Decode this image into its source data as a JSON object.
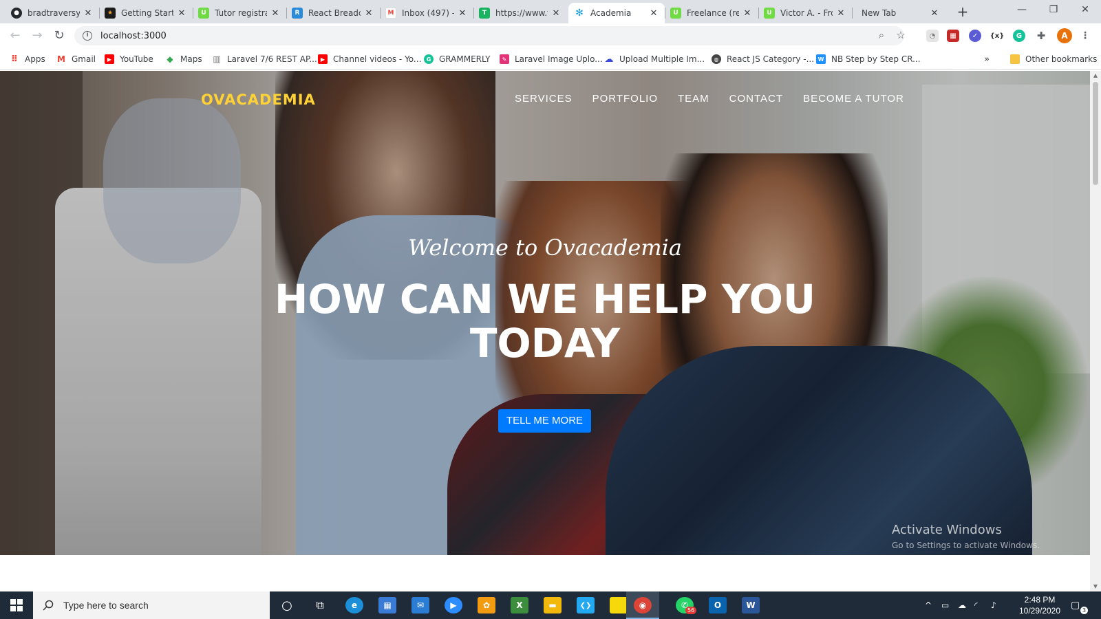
{
  "browser": {
    "tabs": [
      {
        "title": "bradtraversy (",
        "fav": "#24292e",
        "glyph": "●"
      },
      {
        "title": "Getting Starte",
        "fav": "#1b1b1b",
        "glyph": "★"
      },
      {
        "title": "Tutor registra",
        "fav": "#6fda44",
        "glyph": "U"
      },
      {
        "title": "React Breadcr",
        "fav": "#2b8ad8",
        "glyph": "R"
      },
      {
        "title": "Inbox (497) - ",
        "fav": "#ffffff",
        "glyph": "M"
      },
      {
        "title": "https://www.t",
        "fav": "#18b360",
        "glyph": "T"
      },
      {
        "title": "Academia",
        "fav": "#1b9bd7",
        "glyph": "✻"
      },
      {
        "title": "Freelance (rea",
        "fav": "#6fda44",
        "glyph": "U"
      },
      {
        "title": "Victor A. - Fro",
        "fav": "#6fda44",
        "glyph": "U"
      },
      {
        "title": "New Tab",
        "fav": "",
        "glyph": ""
      }
    ],
    "url": "localhost:3000",
    "profile_initial": "A",
    "bookmarks": [
      {
        "label": "Apps",
        "fav": "#e94235",
        "glyph": "⠿"
      },
      {
        "label": "Gmail",
        "fav": "#ea4335",
        "glyph": "M"
      },
      {
        "label": "YouTube",
        "fav": "#ff0000",
        "glyph": "▶"
      },
      {
        "label": "Maps",
        "fav": "#34a853",
        "glyph": "◆"
      },
      {
        "label": "Laravel 7/6 REST AP...",
        "fav": "#777777",
        "glyph": "▥"
      },
      {
        "label": "Channel videos - Yo...",
        "fav": "#ff0000",
        "glyph": "▶"
      },
      {
        "label": "GRAMMERLY",
        "fav": "#15c39a",
        "glyph": "G"
      },
      {
        "label": "Laravel Image Uplo...",
        "fav": "#e3347a",
        "glyph": "✎"
      },
      {
        "label": "Upload Multiple Im...",
        "fav": "#3c4bd6",
        "glyph": "☁"
      },
      {
        "label": "React JS Category -...",
        "fav": "#444444",
        "glyph": "◍"
      },
      {
        "label": "NB Step by Step CR...",
        "fav": "#1e90ff",
        "glyph": "W"
      }
    ],
    "other_bookmarks": "Other bookmarks"
  },
  "page": {
    "brand": "OVACADEMIA",
    "nav": [
      "SERVICES",
      "PORTFOLIO",
      "TEAM",
      "CONTACT",
      "BECOME A TUTOR"
    ],
    "subheading": "Welcome to Ovacademia",
    "heading_line1": "HOW CAN WE HELP YOU",
    "heading_line2": "TODAY",
    "cta": "TELL ME MORE",
    "colors": {
      "brand": "#fed136",
      "cta": "#007bff"
    }
  },
  "watermark": {
    "title": "Activate Windows",
    "subtitle": "Go to Settings to activate Windows."
  },
  "taskbar": {
    "search_placeholder": "Type here to search",
    "time": "2:48 PM",
    "date": "10/29/2020",
    "whatsapp_badge": "56",
    "notification_count": "3",
    "apps": [
      {
        "name": "cortana-icon",
        "color": "",
        "glyph": "○"
      },
      {
        "name": "task-view-icon",
        "color": "",
        "glyph": "⧉"
      },
      {
        "name": "edge-icon",
        "color": "#1b8fd8",
        "glyph": "e"
      },
      {
        "name": "store-icon",
        "color": "#3a7bd5",
        "glyph": "▦"
      },
      {
        "name": "mail-icon",
        "color": "#2b7cd3",
        "glyph": "✉"
      },
      {
        "name": "zoom-icon",
        "color": "#2d8cff",
        "glyph": "▶"
      },
      {
        "name": "app-orange-icon",
        "color": "#f39c12",
        "glyph": "✿"
      },
      {
        "name": "excel-like-icon",
        "color": "#3c8d3c",
        "glyph": "X"
      },
      {
        "name": "file-explorer-icon",
        "color": "#f2b90c",
        "glyph": "▬"
      },
      {
        "name": "vscode-icon",
        "color": "#23a9f2",
        "glyph": "❮❯"
      },
      {
        "name": "sticky-notes-icon",
        "color": "#f5d90a",
        "glyph": ""
      },
      {
        "name": "chrome-icon",
        "color": "#db4437",
        "glyph": "◉"
      },
      {
        "name": "whatsapp-icon",
        "color": "#25d366",
        "glyph": "✆"
      },
      {
        "name": "outlook-icon",
        "color": "#0a64ad",
        "glyph": "O"
      },
      {
        "name": "word-icon",
        "color": "#2b579a",
        "glyph": "W"
      }
    ]
  }
}
